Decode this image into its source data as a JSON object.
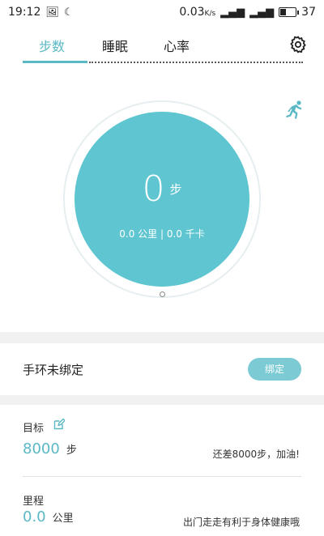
{
  "status_bar": {
    "time": "19:12",
    "network_speed": "0.03",
    "network_unit": "K/s",
    "battery": "37"
  },
  "tabs": [
    {
      "label": "步数",
      "active": true
    },
    {
      "label": "睡眠",
      "active": false
    },
    {
      "label": "心率",
      "active": false
    }
  ],
  "icons": {
    "settings": "gear-icon",
    "activity": "running-person-icon",
    "edit": "edit-icon"
  },
  "summary": {
    "steps": "0",
    "steps_unit": "步",
    "distance_line": "0.0 公里 | 0.0 千卡"
  },
  "band": {
    "label": "手环未绑定",
    "bind_label": "绑定"
  },
  "goal": {
    "label": "目标",
    "value": "8000",
    "unit": "步",
    "message": "还差8000步，加油!"
  },
  "distance": {
    "label": "里程",
    "value": "0.0",
    "unit": "公里",
    "message": "出门走走有利于身体健康哦"
  },
  "colors": {
    "accent": "#5bb8c5",
    "circle": "#5fc6d1",
    "button": "#7ccbd4"
  }
}
